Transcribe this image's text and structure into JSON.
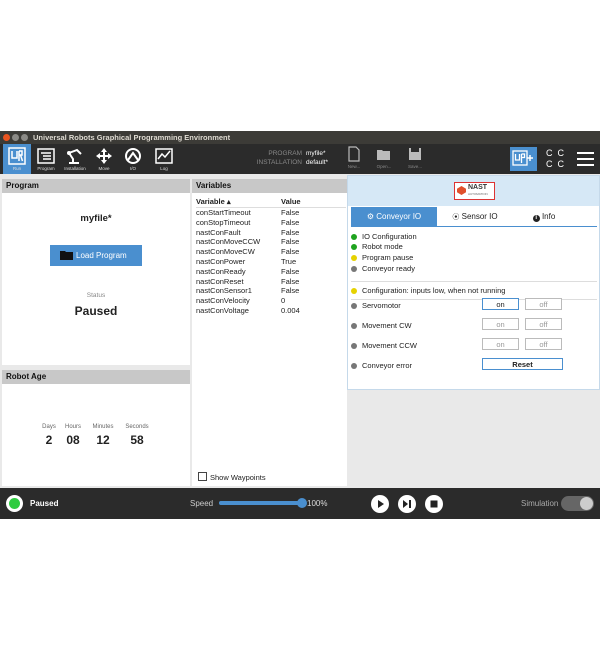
{
  "window": {
    "title": "Universal Robots Graphical Programming Environment"
  },
  "toolbar": {
    "tabs": [
      {
        "label": "Run"
      },
      {
        "label": "Program"
      },
      {
        "label": "Installation"
      },
      {
        "label": "Move"
      },
      {
        "label": "I/O"
      },
      {
        "label": "Log"
      }
    ],
    "program_key": "PROGRAM",
    "program_value": "myfile*",
    "installation_key": "INSTALLATION",
    "installation_value": "default*",
    "file_buttons": [
      {
        "label": "New..."
      },
      {
        "label": "Open..."
      },
      {
        "label": "Save..."
      }
    ],
    "cc_text": [
      "C",
      "C",
      "C",
      "C"
    ]
  },
  "program_panel": {
    "header": "Program",
    "filename": "myfile*",
    "load_button": "Load Program",
    "status_label": "Status",
    "status_value": "Paused"
  },
  "robot_age": {
    "header": "Robot Age",
    "units": [
      {
        "label": "Days",
        "value": "2"
      },
      {
        "label": "Hours",
        "value": "08"
      },
      {
        "label": "Minutes",
        "value": "12"
      },
      {
        "label": "Seconds",
        "value": "58"
      }
    ]
  },
  "variables": {
    "header": "Variables",
    "col_variable": "Variable ▴",
    "col_value": "Value",
    "rows": [
      {
        "name": "conStartTimeout",
        "value": "False"
      },
      {
        "name": "conStopTimeout",
        "value": "False"
      },
      {
        "name": "nastConFault",
        "value": "False"
      },
      {
        "name": "nastConMoveCCW",
        "value": "False"
      },
      {
        "name": "nastConMoveCW",
        "value": "False"
      },
      {
        "name": "nastConPower",
        "value": "True"
      },
      {
        "name": "nastConReady",
        "value": "False"
      },
      {
        "name": "nastConReset",
        "value": "False"
      },
      {
        "name": "nastConSensor1",
        "value": "False"
      },
      {
        "name": "nastConVelocity",
        "value": "0"
      },
      {
        "name": "nastConVoltage",
        "value": "0.004"
      }
    ],
    "show_waypoints": "Show Waypoints"
  },
  "nast": {
    "logo_text": "NAST",
    "logo_sub": "AUTOMATION",
    "tabs": [
      {
        "label": "Conveyor IO"
      },
      {
        "label": "Sensor IO"
      },
      {
        "label": "Info"
      }
    ],
    "status_items": [
      {
        "text": "IO Configuration",
        "color": "#1fa31f"
      },
      {
        "text": "Robot mode",
        "color": "#1fa31f"
      },
      {
        "text": "Program pause",
        "color": "#e6d200"
      },
      {
        "text": "Conveyor ready",
        "color": "#777777"
      }
    ],
    "config_note": "Configuration: inputs low, when not running",
    "config_color": "#e6d200",
    "controls": [
      {
        "label": "Servomotor",
        "on": "on",
        "off": "off"
      },
      {
        "label": "Movement CW",
        "on": "on",
        "off": "off"
      },
      {
        "label": "Movement CCW",
        "on": "on",
        "off": "off"
      }
    ],
    "error_label": "Conveyor error",
    "reset_button": "Reset"
  },
  "bottom": {
    "status": "Paused",
    "speed_label": "Speed",
    "speed_value": "100%",
    "speed_fraction": 1.0,
    "simulation_label": "Simulation"
  },
  "colors": {
    "accent": "#4a8fcf",
    "bar_dark": "#2b2b2b",
    "status_green": "#2ecc40"
  }
}
